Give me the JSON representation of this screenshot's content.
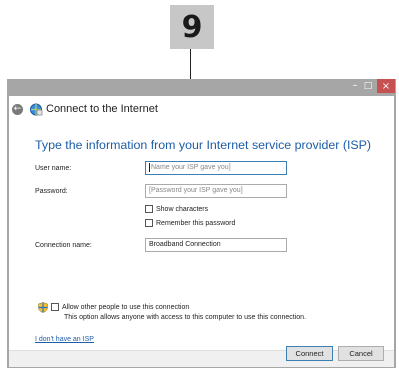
{
  "callout": {
    "number": "9"
  },
  "window": {
    "controls": {
      "minimize": "–",
      "maximize": "□",
      "close": "×"
    },
    "nav_title": "Connect to the Internet",
    "heading": "Type the information from your Internet service provider (ISP)",
    "form": {
      "username_label": "User name:",
      "username_placeholder": "Name your ISP gave you]",
      "password_label": "Password:",
      "password_placeholder": "[Password your ISP gave you]",
      "show_characters": "Show characters",
      "remember_password": "Remember this password",
      "connection_name_label": "Connection name:",
      "connection_name_value": "Broadband Connection"
    },
    "allow_others": "Allow other people to use this connection",
    "allow_desc": "This option allows anyone with access to this computer to use this connection.",
    "no_isp_link": "I don't have an ISP",
    "buttons": {
      "connect": "Connect",
      "cancel": "Cancel"
    }
  },
  "colors": {
    "accent": "#1e5ea8",
    "titlebar": "#a6a6a6",
    "close": "#c75050"
  }
}
